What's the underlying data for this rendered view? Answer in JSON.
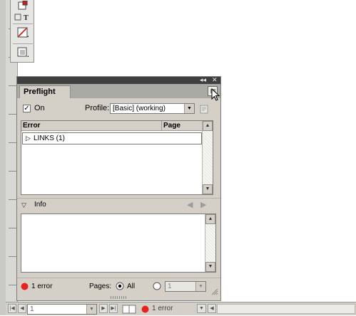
{
  "panel": {
    "tab_label": "Preflight",
    "on_label": "On",
    "on_checked": "✓",
    "profile_label": "Profile:",
    "profile_value": "[Basic] (working)",
    "columns": {
      "error": "Error",
      "page": "Page"
    },
    "errors": [
      {
        "label": "LINKS (1)"
      }
    ],
    "info_label": "Info",
    "footer": {
      "error_count": "1 error",
      "pages_label": "Pages:",
      "pages_all_label": "All",
      "page_range_value": "1"
    },
    "colors": {
      "error_red": "#e8231f",
      "titlebar": "#3f3f3f",
      "panel_bg": "#d4d0c8"
    }
  },
  "status_bar": {
    "page_value": "1",
    "error_text": "1 error"
  },
  "icons": [
    "tool-icon",
    "type-tool-icon",
    "fill-stroke-icon",
    "view-mode-icon",
    "collapse-icon",
    "close-icon",
    "panel-menu-icon",
    "profile-options-icon",
    "disclosure-triangle-icon",
    "previous-icon",
    "next-icon",
    "error-dot-icon",
    "radio-icon"
  ]
}
